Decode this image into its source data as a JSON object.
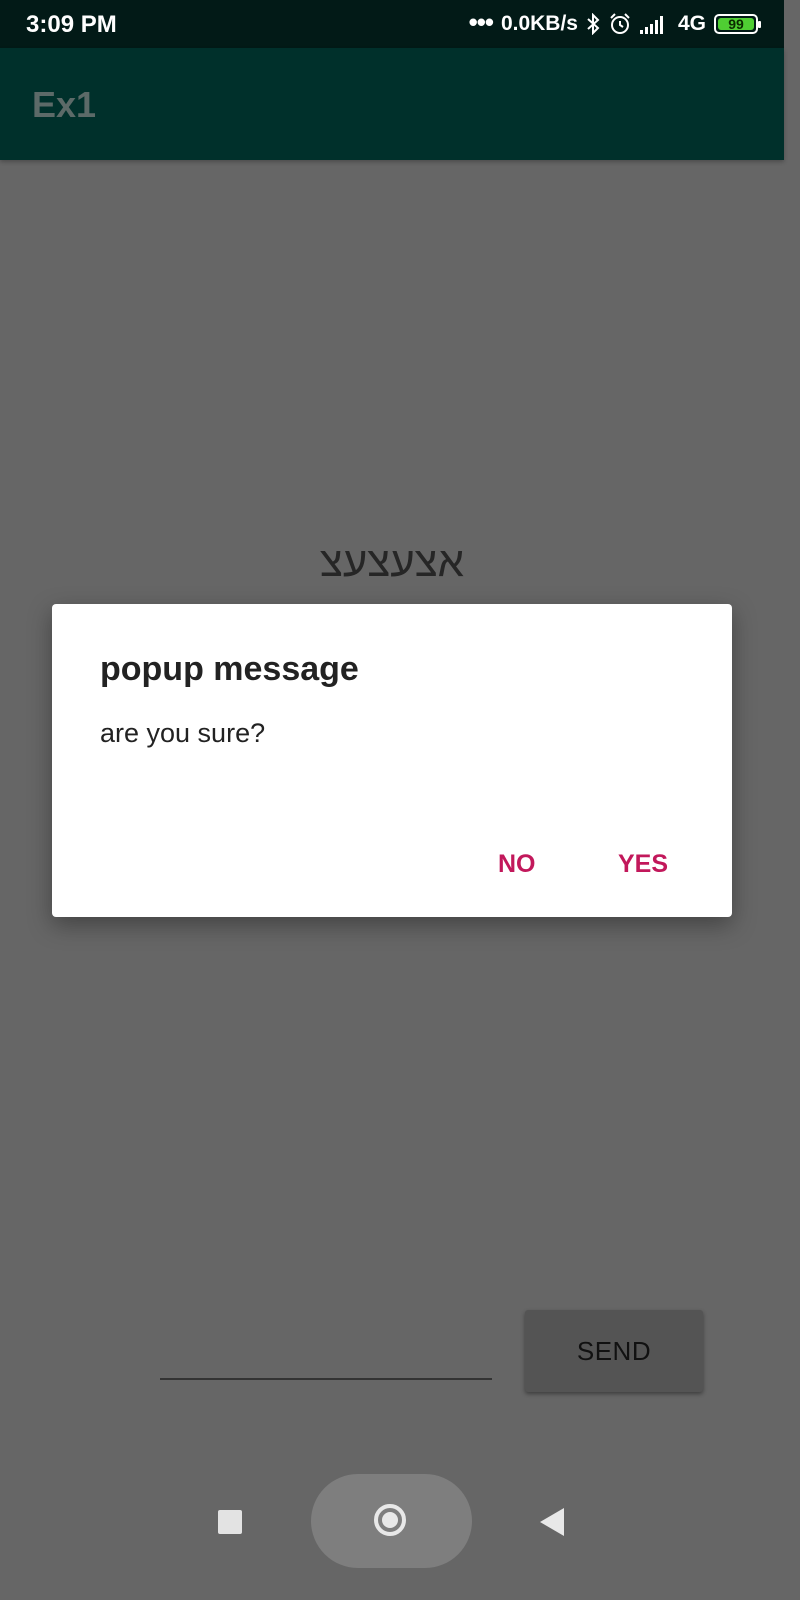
{
  "status_bar": {
    "time": "3:09 PM",
    "dots": "•••",
    "network_speed": "0.0KB/s",
    "network_type": "4G",
    "battery_level": "99",
    "icons": [
      "bluetooth-icon",
      "alarm-icon",
      "signal-icon",
      "battery-icon"
    ]
  },
  "app_bar": {
    "title": "Ex1",
    "color": "#00302b"
  },
  "main": {
    "center_text": "אצעצעצ",
    "input": {
      "value": "",
      "placeholder": ""
    },
    "send_label": "SEND"
  },
  "dialog": {
    "title": "popup message",
    "message": "are you sure?",
    "negative_label": "NO",
    "positive_label": "YES",
    "button_color": "#c2185b"
  },
  "nav_bar": {
    "icons": [
      "recent-apps-icon",
      "home-icon",
      "back-icon"
    ]
  }
}
